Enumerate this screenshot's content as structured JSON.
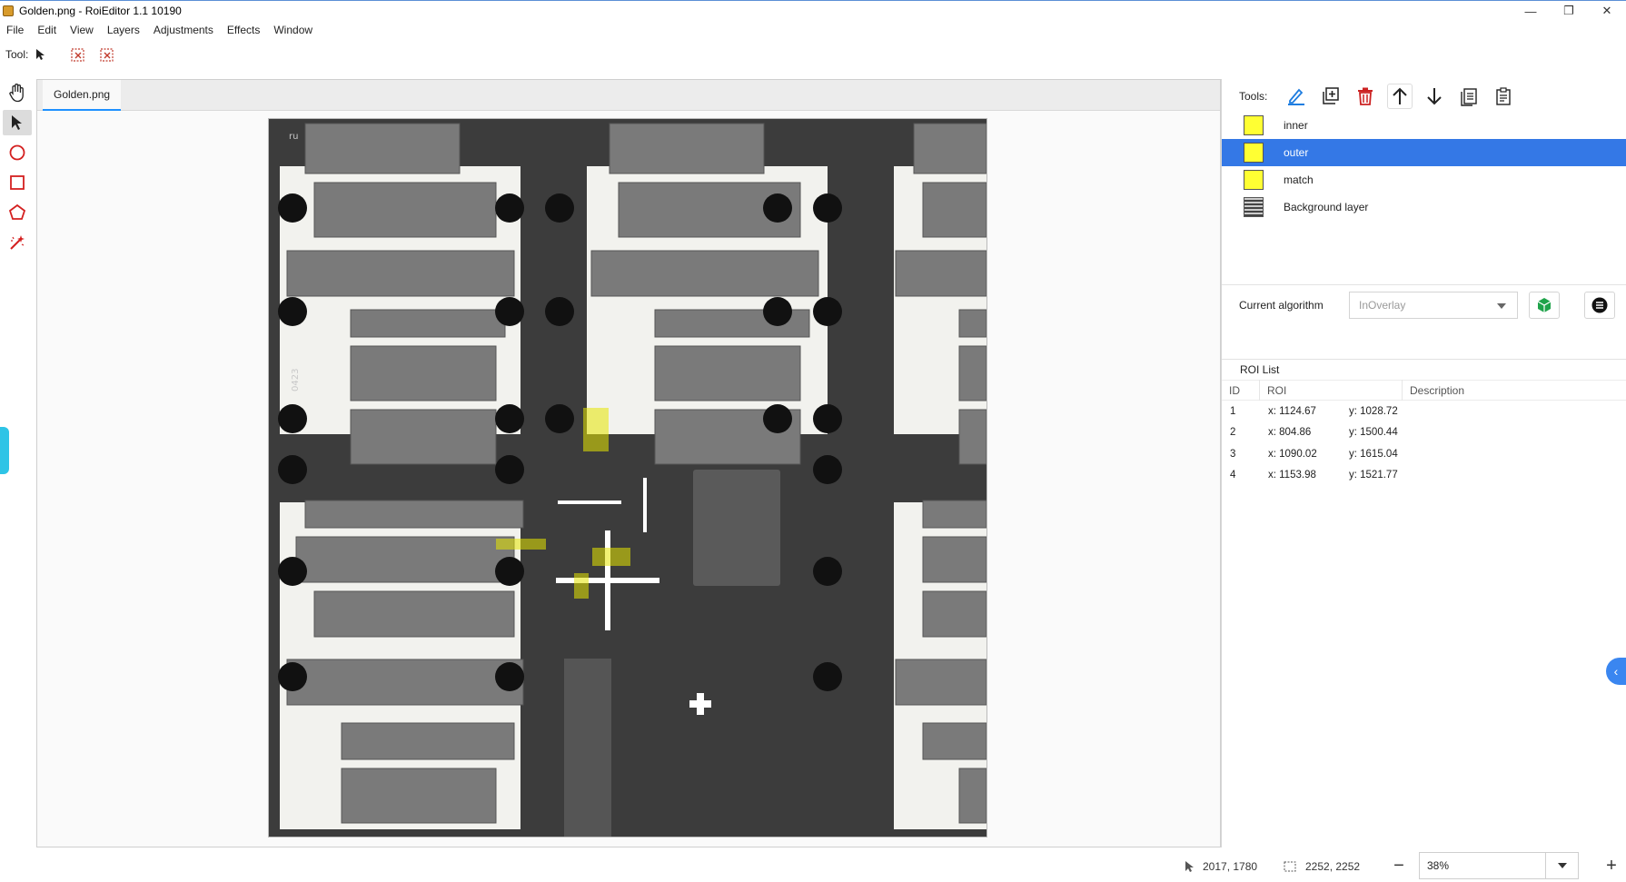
{
  "window": {
    "title": "Golden.png - RoiEditor 1.1 10190",
    "minimize_glyph": "—",
    "maximize_glyph": "❐",
    "close_glyph": "✕"
  },
  "menu": [
    "File",
    "Edit",
    "View",
    "Layers",
    "Adjustments",
    "Effects",
    "Window"
  ],
  "toolbar": {
    "tool_label": "Tool:",
    "icons": [
      "pointer-icon",
      "clear-selection-icon",
      "clear-roi-icon"
    ]
  },
  "left_tools": [
    "hand-icon",
    "select-arrow-icon",
    "ellipse-icon",
    "rectangle-icon",
    "polygon-icon",
    "magic-wand-icon"
  ],
  "document": {
    "tab_label": "Golden.png"
  },
  "right_panel": {
    "tools_label": "Tools:",
    "tool_icons": [
      "edit-icon",
      "add-layer-icon",
      "delete-icon",
      "move-up-icon",
      "move-down-icon",
      "copy-icon",
      "paste-icon"
    ],
    "layers": [
      {
        "name": "inner",
        "color": "#ffff33",
        "selected": false
      },
      {
        "name": "outer",
        "color": "#ffff33",
        "selected": true
      },
      {
        "name": "match",
        "color": "#ffff33",
        "selected": false
      },
      {
        "name": "Background layer",
        "color": "image",
        "selected": false
      }
    ],
    "algorithm_label": "Current algorithm",
    "algorithm_value": "InOverlay",
    "roi_list_title": "ROI List",
    "roi_columns": [
      "ID",
      "ROI",
      "Description"
    ],
    "roi_rows": [
      {
        "id": "1",
        "x": "x: 1124.67",
        "y": "y: 1028.72",
        "description": ""
      },
      {
        "id": "2",
        "x": "x: 804.86",
        "y": "y: 1500.44",
        "description": ""
      },
      {
        "id": "3",
        "x": "x: 1090.02",
        "y": "y: 1615.04",
        "description": ""
      },
      {
        "id": "4",
        "x": "x: 1153.98",
        "y": "y: 1521.77",
        "description": ""
      }
    ]
  },
  "status": {
    "cursor_pos": "2017, 1780",
    "image_size": "2252, 2252",
    "zoom": "38%",
    "zoom_out_glyph": "−",
    "zoom_in_glyph": "+"
  },
  "image_labels": {
    "part_code": "0423",
    "corner_mark": "ru"
  },
  "colors": {
    "accent": "#3478e6",
    "roi_overlay": "#e6e600",
    "board_dark": "#3c3c3c",
    "pad_gray": "#7a7a7a",
    "background": "#f4f4f2"
  }
}
